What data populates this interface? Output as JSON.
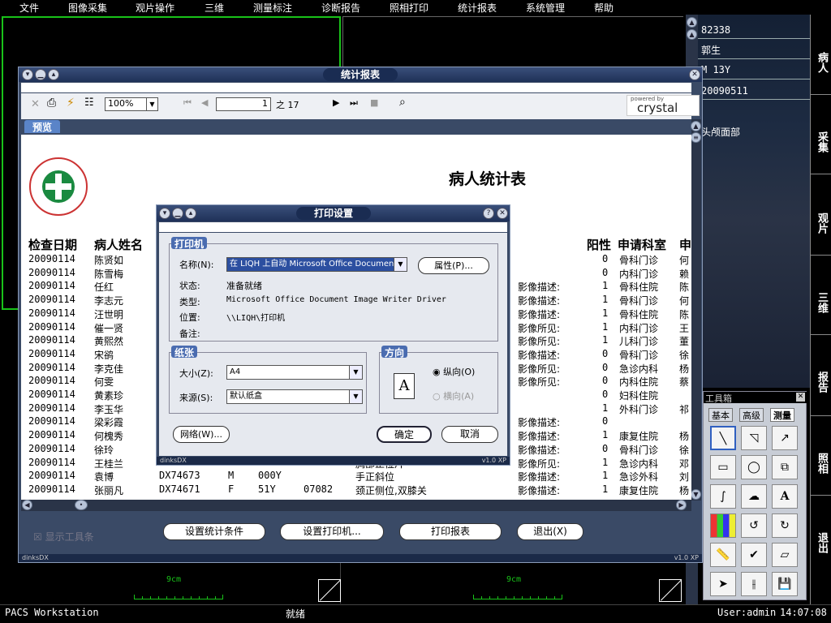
{
  "menubar": [
    "文件",
    "图像采集",
    "观片操作",
    "三维",
    "测量标注",
    "诊断报告",
    "照相打印",
    "统计报表",
    "系统管理",
    "帮助"
  ],
  "patient_info": {
    "id": "82338",
    "name": "郭生",
    "sex_age": "M 13Y",
    "date": "20090511",
    "body_part": "头颅面部"
  },
  "right_tabs": [
    "病人",
    "采集",
    "观片",
    "三维",
    "报告",
    "照相",
    "退出"
  ],
  "viewport": {
    "scale_label": "9cm"
  },
  "toolbox": {
    "title": "工具箱",
    "tabs": [
      "基本",
      "高级",
      "测量"
    ],
    "tools": [
      "line-tool",
      "angle-tool",
      "arrow-tool",
      "rect-tool",
      "ellipse-tool",
      "copy-tool",
      "freehand-tool",
      "cloud-tool",
      "text-tool",
      "color-tool",
      "undo-tool",
      "redo-tool",
      "ruler-tool",
      "check-tool",
      "eraser-tool",
      "pointer-tool",
      "split-tool",
      "save-tool"
    ]
  },
  "statusbar": {
    "app": "PACS Workstation",
    "status": "就绪",
    "user": "User:admin",
    "time": "14:07:08"
  },
  "report_window": {
    "title": "统计报表",
    "zoom": "100%",
    "page_current": "1",
    "page_of": "之 17",
    "crystal_top": "powered by",
    "crystal_brand": "crystal",
    "preview_tab": "预览",
    "report_title": "病人统计表",
    "columns": {
      "date": "检查日期",
      "name": "病人姓名",
      "positive": "阳性",
      "dept": "申请科室",
      "apply": "申"
    },
    "rows": [
      {
        "date": "20090114",
        "name": "陈贤如",
        "desc": "",
        "pos": "0",
        "dept": "骨科门诊",
        "x": "何"
      },
      {
        "date": "20090114",
        "name": "陈雪梅",
        "desc": "",
        "pos": "0",
        "dept": "内科门诊",
        "x": "赖"
      },
      {
        "date": "20090114",
        "name": "任红",
        "desc": "影像描述:",
        "pos": "1",
        "dept": "骨科住院",
        "x": "陈"
      },
      {
        "date": "20090114",
        "name": "李志元",
        "desc": "影像描述:",
        "pos": "1",
        "dept": "骨科门诊",
        "x": "何"
      },
      {
        "date": "20090114",
        "name": "汪世明",
        "desc": "影像描述:",
        "pos": "1",
        "dept": "骨科住院",
        "x": "陈"
      },
      {
        "date": "20090114",
        "name": "催一贤",
        "desc": "影像所见:",
        "pos": "1",
        "dept": "内科门诊",
        "x": "王"
      },
      {
        "date": "20090114",
        "name": "黄熙然",
        "desc": "影像所见:",
        "pos": "1",
        "dept": "儿科门诊",
        "x": "董"
      },
      {
        "date": "20090114",
        "name": "宋鹆",
        "desc": "影像描述:",
        "pos": "0",
        "dept": "骨科门诊",
        "x": "徐"
      },
      {
        "date": "20090114",
        "name": "李克佳",
        "desc": "影像所见:",
        "pos": "0",
        "dept": "急诊内科",
        "x": "杨"
      },
      {
        "date": "20090114",
        "name": "何雯",
        "desc": "影像所见:",
        "pos": "0",
        "dept": "内科住院",
        "x": "蔡"
      },
      {
        "date": "20090114",
        "name": "黄素珍",
        "desc": "",
        "pos": "0",
        "dept": "妇科住院",
        "x": ""
      },
      {
        "date": "20090114",
        "name": "李玉华",
        "desc": "",
        "pos": "1",
        "dept": "外科门诊",
        "x": "祁"
      },
      {
        "date": "20090114",
        "name": "梁彩霞",
        "desc": "影像描述:",
        "pos": "0",
        "dept": "",
        "x": ""
      },
      {
        "date": "20090114",
        "name": "何槐秀",
        "desc": "影像描述:",
        "pos": "1",
        "dept": "康复住院",
        "x": "杨"
      },
      {
        "date": "20090114",
        "name": "徐玲",
        "desc": "影像描述:",
        "pos": "0",
        "dept": "骨科门诊",
        "x": "徐"
      },
      {
        "date": "20090114",
        "name": "王桂兰",
        "code": "DX74672",
        "sex": "F",
        "age": "60Y",
        "exam": "胸部正位片",
        "desc": "影像所见:",
        "pos": "1",
        "dept": "急诊内科",
        "x": "邓"
      },
      {
        "date": "20090114",
        "name": "袁博",
        "code": "DX74673",
        "sex": "M",
        "age": "000Y",
        "exam": "手正斜位",
        "desc": "影像描述:",
        "pos": "1",
        "dept": "急诊外科",
        "x": "刘"
      },
      {
        "date": "20090114",
        "name": "张丽凡",
        "code": "DX74671",
        "sex": "F",
        "age": "51Y",
        "code2": "07082",
        "exam": "颈正侧位,双膝关",
        "desc": "影像描述:",
        "pos": "1",
        "dept": "康复住院",
        "x": "杨"
      }
    ],
    "show_toolbar": "显示工具条",
    "buttons": {
      "set_cond": "设置统计条件",
      "set_printer": "设置打印机...",
      "print": "打印报表",
      "exit": "退出(X)"
    },
    "footer_left": "dinksDX",
    "footer_right": "v1.0 XP"
  },
  "print_dialog": {
    "title": "打印设置",
    "printer_group": "打印机",
    "name_label": "名称(N):",
    "name_value": "在 LIQH 上自动 Microsoft Office Document Image Writer",
    "properties_btn": "属性(P)...",
    "status_label": "状态:",
    "status_value": "准备就绪",
    "type_label": "类型:",
    "type_value": "Microsoft Office Document Image Writer Driver",
    "where_label": "位置:",
    "where_value": "\\\\LIQH\\打印机",
    "comment_label": "备注:",
    "paper_group": "纸张",
    "size_label": "大小(Z):",
    "size_value": "A4",
    "source_label": "来源(S):",
    "source_value": "默认纸盒",
    "orient_group": "方向",
    "portrait": "纵向(O)",
    "landscape": "横向(A)",
    "network_btn": "网络(W)...",
    "ok_btn": "确定",
    "cancel_btn": "取消",
    "footer_left": "dinksDX",
    "footer_right": "v1.0 XP"
  }
}
